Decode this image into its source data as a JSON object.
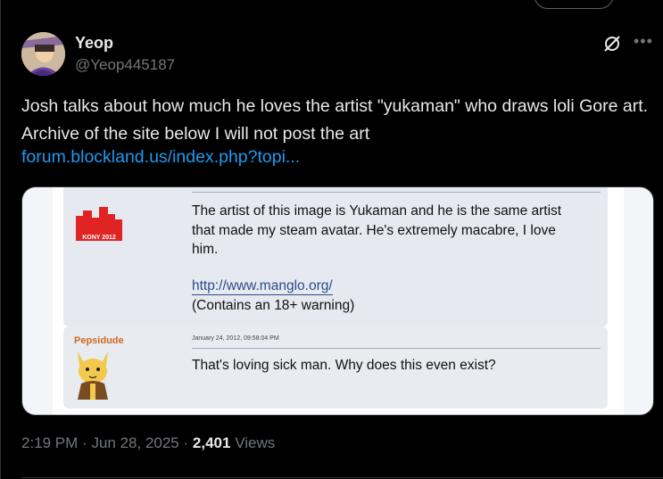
{
  "author": {
    "display_name": "Yeop",
    "handle": "@Yeop445187"
  },
  "tweet": {
    "text": "Josh talks about how much he loves the artist \"yukaman\" who draws loli Gore art. Archive of the site below I will not post the art",
    "link": "forum.blockland.us/index.php?topi..."
  },
  "forum": {
    "post1": {
      "avatar_caption": "KONY 2012",
      "text": "The artist of this image is Yukaman and he is the same artist that made my steam avatar. He's extremely macabre, I love him.",
      "link": "http://www.manglo.org/",
      "warning": "(Contains an 18+ warning)"
    },
    "post2": {
      "author": "Pepsidude",
      "date": "January 24, 2012, 09:58:04 PM",
      "text": "That's loving sick man. Why does this even exist?"
    }
  },
  "meta": {
    "time": "2:19 PM",
    "sep1": "·",
    "date": "Jun 28, 2025",
    "sep2": "·",
    "views_count": "2,401",
    "views_label": "Views"
  },
  "icons": {
    "grok": "grok-icon",
    "more": "more-icon"
  },
  "colors": {
    "link": "#1d9bf0",
    "secondary_text": "#71767b",
    "background": "#000000"
  }
}
